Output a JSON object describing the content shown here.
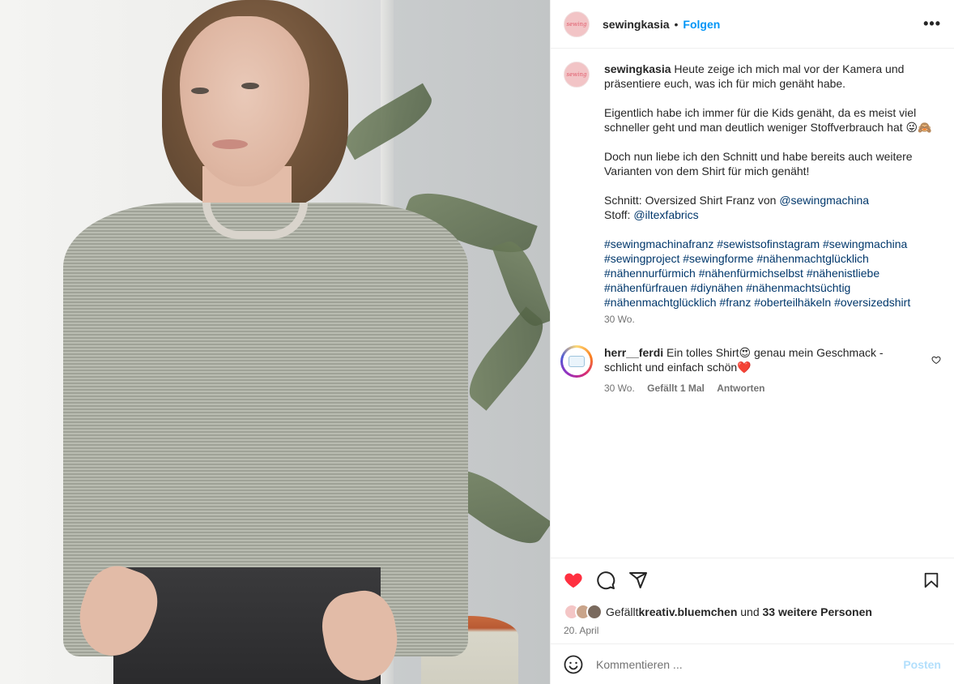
{
  "post": {
    "username": "sewingkasia",
    "follow_label": "Folgen",
    "separator": "•",
    "more_label": "•••",
    "avatar_text": "sewing"
  },
  "caption": {
    "username": "sewingkasia",
    "p1_text": " Heute zeige ich mich mal vor der Kamera und präsentiere euch, was ich für mich genäht habe.",
    "p2_text": "Eigentlich habe ich immer für die Kids genäht, da es meist viel schneller geht und man deutlich weniger Stoffverbrauch hat 😜🙈",
    "p3_text": "Doch nun liebe ich den Schnitt und habe bereits auch weitere Varianten von dem Shirt für mich genäht!",
    "schnitt_label": "Schnitt: Oversized Shirt Franz von ",
    "schnitt_mention": "@sewingmachina",
    "stoff_label": "Stoff: ",
    "stoff_mention": "@iltexfabrics",
    "hashtags": "#sewingmachinafranz #sewistsofinstagram #sewingmachina #sewingproject #sewingforme #nähenmachtglücklich #nähennurfürmich #nähenfürmichselbst #nähenistliebe #nähenfürfrauen #diynähen #nähenmachtsüchtig #nähenmachtglücklich #franz #oberteilhäkeln #oversizedshirt",
    "time": "30 Wo."
  },
  "comment": {
    "username": "herr__ferdi",
    "text": " Ein tolles Shirt😍 genau mein Geschmack - schlicht und einfach schön❤️",
    "time": "30 Wo.",
    "likes": "Gefällt 1 Mal",
    "reply_label": "Antworten"
  },
  "likes": {
    "prefix": "Gefällt ",
    "first_liker": "kreativ.bluemchen",
    "middle": " und ",
    "others": "33 weitere Personen",
    "liker_colors": [
      "#f4c6c6",
      "#c9a48a",
      "#7a6a5e"
    ]
  },
  "date": "20. April",
  "add_comment": {
    "placeholder": "Kommentieren ...",
    "post_label": "Posten"
  },
  "colors": {
    "accent": "#0095f6",
    "like_red": "#ff3040",
    "link": "#00376b"
  },
  "icons": [
    "emoji-smiley-icon",
    "heart-filled-icon",
    "comment-icon",
    "share-icon",
    "bookmark-icon",
    "more-icon",
    "heart-outline-icon"
  ]
}
